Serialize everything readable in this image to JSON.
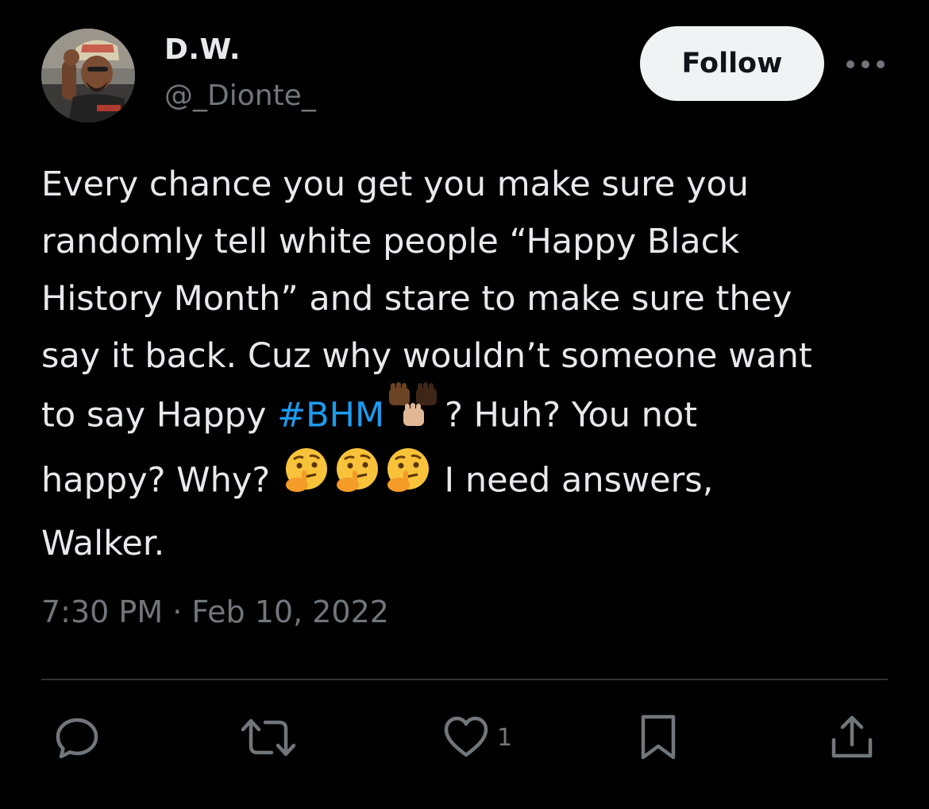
{
  "author": {
    "display_name": "D.W.",
    "handle": "@_Dionte_"
  },
  "follow_label": "Follow",
  "tweet": {
    "lines": [
      "Every chance you get you make sure you",
      "randomly tell white people “Happy Black",
      "History Month” and stare to make sure they",
      "say it back. Cuz why wouldn’t someone want"
    ],
    "line5_prefix": "to say Happy ",
    "hashtag": "#BHM",
    "line5_suffix": "? Huh? You not",
    "line6_prefix": "happy? Why? ",
    "line6_suffix": " I need answers,",
    "line7": "Walker."
  },
  "timestamp": "7:30 PM · Feb 10, 2022",
  "actions": {
    "like_count": "1"
  },
  "icons": {
    "more": "more-dots-icon",
    "reply": "reply-icon",
    "retweet": "retweet-icon",
    "like": "heart-icon",
    "bookmark": "bookmark-icon",
    "share": "share-icon",
    "fists_emoji": "raised-fists-emoji",
    "thinking_emoji": "thinking-face-emoji"
  },
  "colors": {
    "background": "#000000",
    "text": "#e7e9ea",
    "secondary": "#71767b",
    "link": "#1d9bf0",
    "divider": "#2f3336",
    "follow_bg": "#eff3f4"
  }
}
